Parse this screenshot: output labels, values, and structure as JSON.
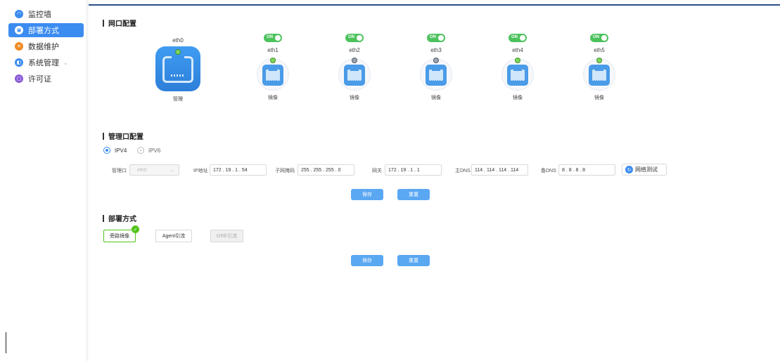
{
  "sidebar": {
    "items": [
      {
        "label": "监控墙",
        "icon": "monitor-icon",
        "color": "#3b8cf0"
      },
      {
        "label": "部署方式",
        "icon": "deploy-icon",
        "color": "#ffffff",
        "active": true
      },
      {
        "label": "数据维护",
        "icon": "data-icon",
        "color": "#f08a24"
      },
      {
        "label": "系统管理",
        "icon": "system-icon",
        "color": "#3b8cf0",
        "chevron": "⌄"
      },
      {
        "label": "许可证",
        "icon": "license-icon",
        "color": "#8a5ad8"
      }
    ]
  },
  "network": {
    "title": "网口配置",
    "ports": [
      {
        "name": "eth0",
        "role": "管理",
        "led": "green"
      },
      {
        "name": "eth1",
        "role": "镜像",
        "toggle": "ON",
        "led": "green"
      },
      {
        "name": "eth2",
        "role": "镜像",
        "toggle": "ON",
        "led": "gray"
      },
      {
        "name": "eth3",
        "role": "镜像",
        "toggle": "ON",
        "led": "gray"
      },
      {
        "name": "eth4",
        "role": "镜像",
        "toggle": "ON",
        "led": "green"
      },
      {
        "name": "eth5",
        "role": "镜像",
        "toggle": "ON",
        "led": "green"
      }
    ]
  },
  "mgmt": {
    "title": "管理口配置",
    "ipv4": "IPV4",
    "ipv6": "IPV6",
    "port_label": "管理口",
    "port_value": "eth0",
    "ip_label": "IP地址",
    "ip": "172 . 19 . 1 . 54",
    "mask_label": "子网掩码",
    "mask": "255 . 255 . 255 . 0",
    "gw_label": "网关",
    "gw": "172 . 19 . 1 . 1",
    "dns1_label": "主DNS",
    "dns1": "114 . 114 . 114 . 114",
    "dns2_label": "备DNS",
    "dns2": "8 . 8 . 8 . 8",
    "test_label": "网络测试",
    "save": "保存",
    "reset": "重置"
  },
  "deploy": {
    "title": "部署方式",
    "modes": [
      "旁路镜像",
      "Agent引流",
      "GRE引流"
    ],
    "save": "保存",
    "reset": "重置"
  }
}
